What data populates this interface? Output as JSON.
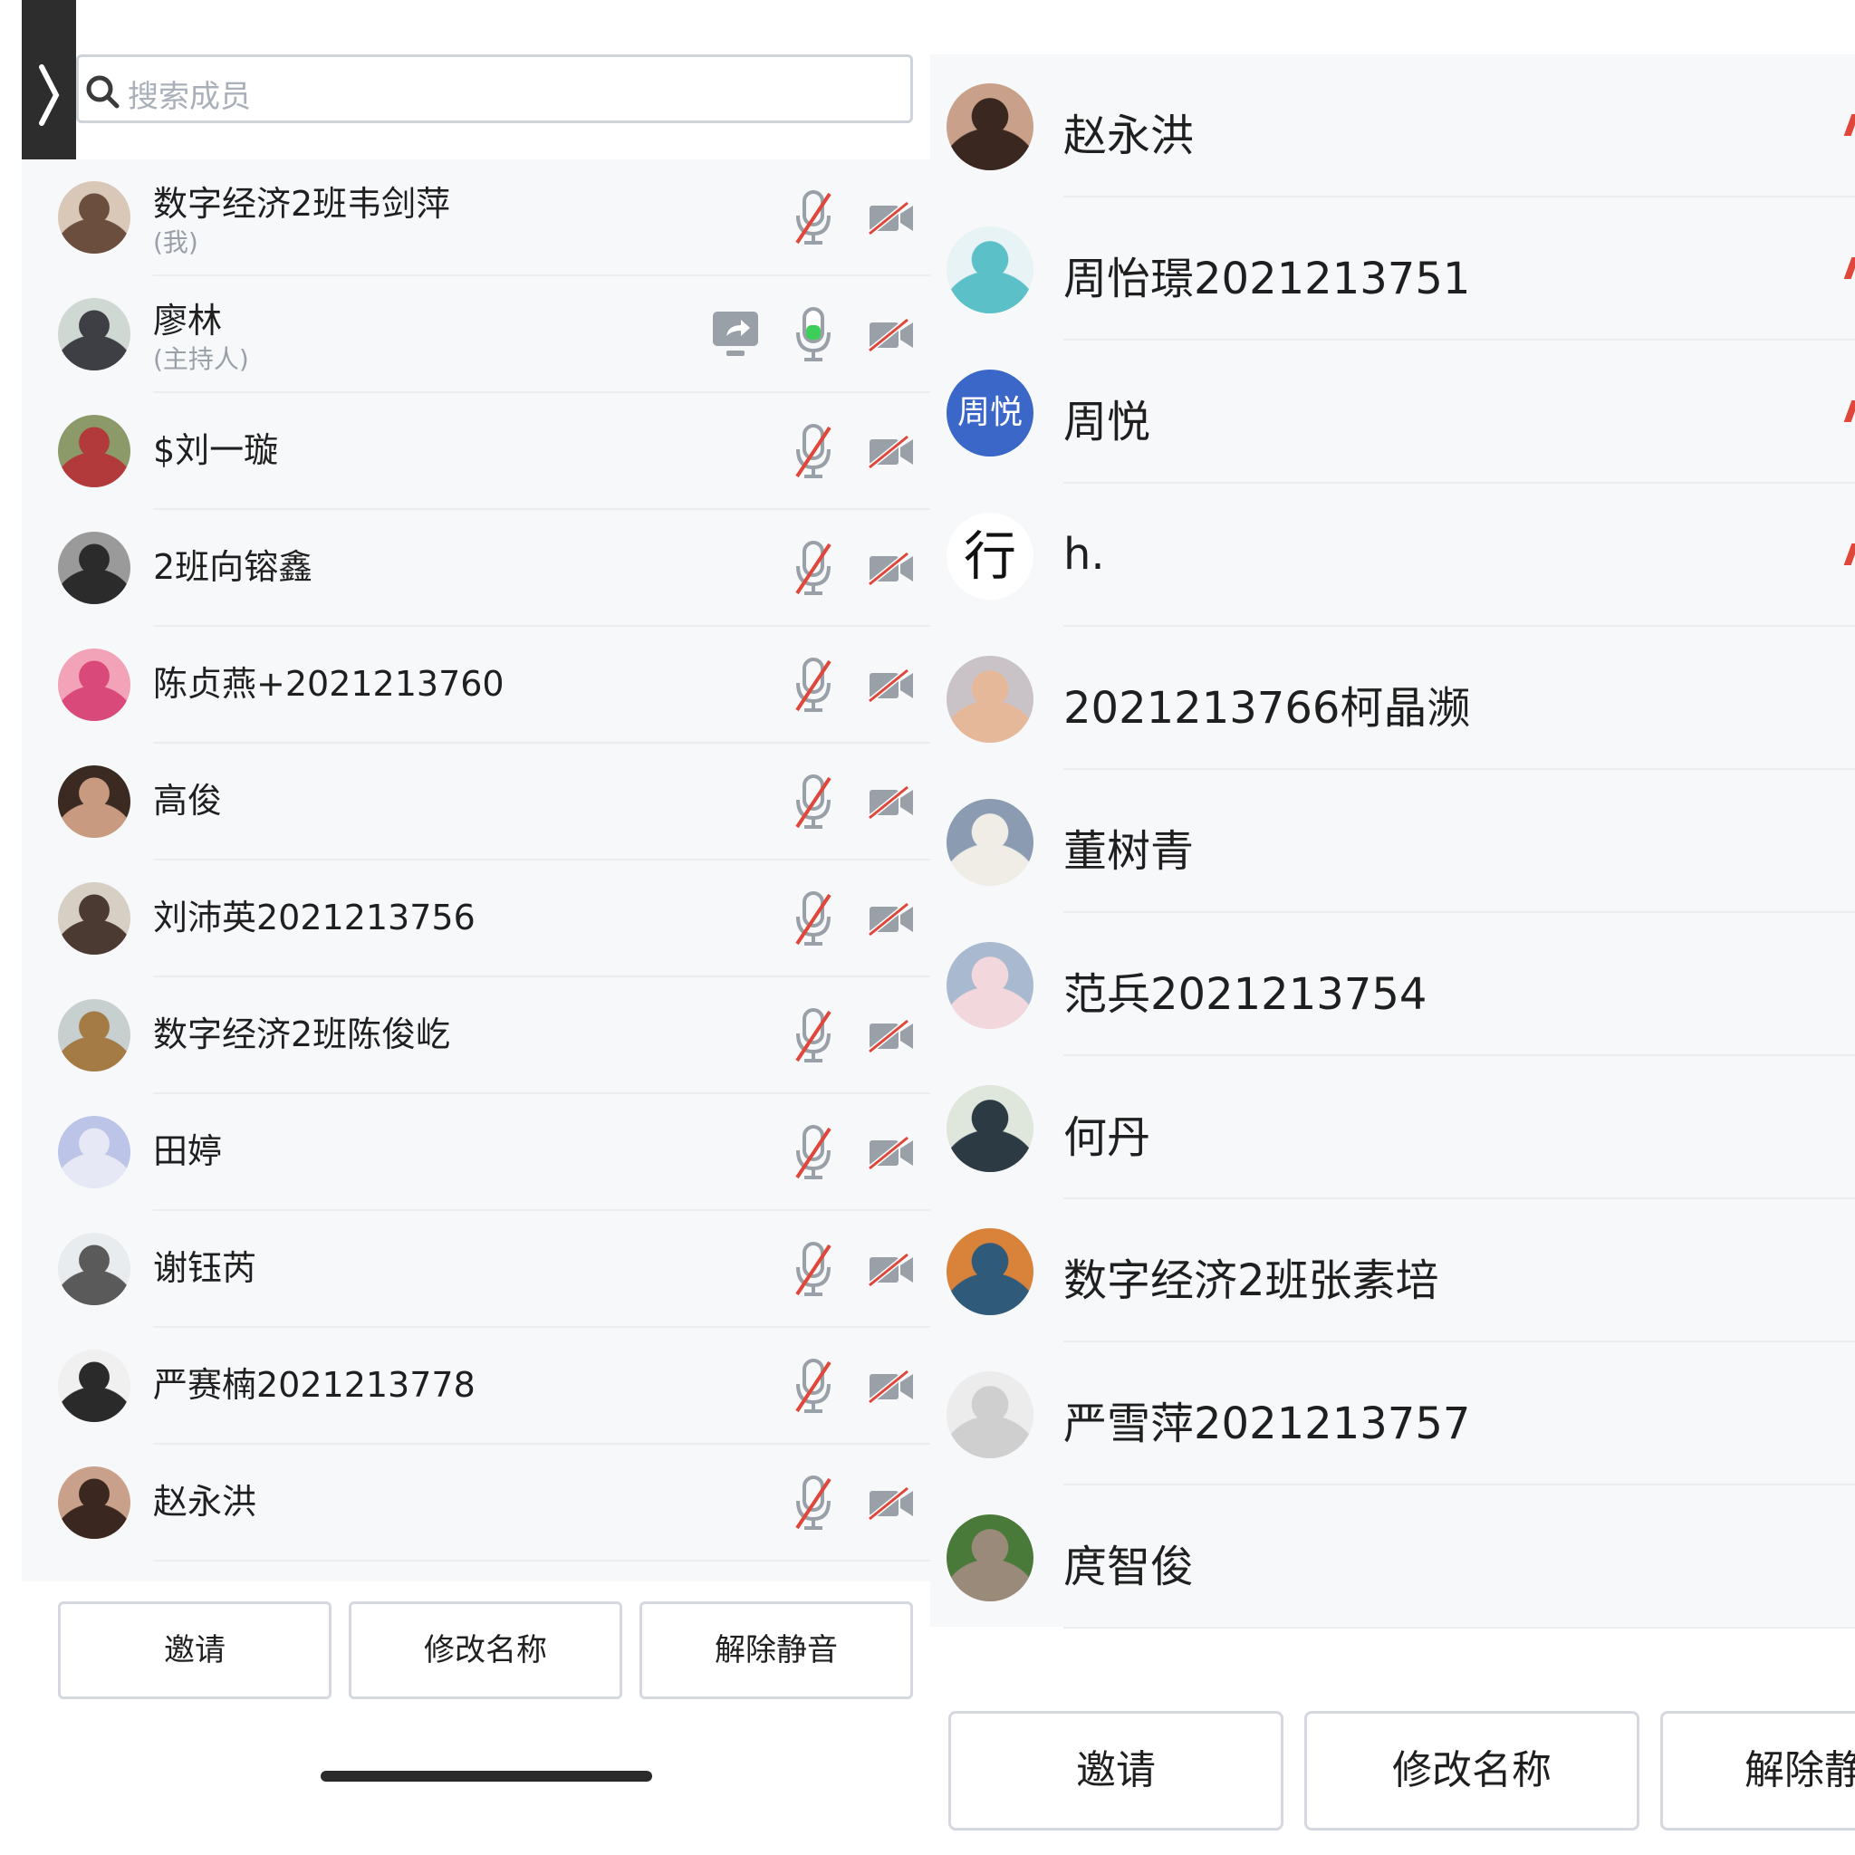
{
  "left_panel": {
    "search": {
      "placeholder": "搜索成员"
    },
    "members": [
      {
        "name": "数字经济2班韦剑萍",
        "role": "(我)",
        "mic": "muted",
        "cam": "off",
        "avatar": "photo"
      },
      {
        "name": "廖林",
        "role": "(主持人)",
        "mic": "on",
        "cam": "off",
        "sharing": true,
        "avatar": "photo"
      },
      {
        "name": "$刘一璇",
        "mic": "muted",
        "cam": "off",
        "avatar": "photo"
      },
      {
        "name": "2班向镕鑫",
        "mic": "muted",
        "cam": "off",
        "avatar": "photo"
      },
      {
        "name": "陈贞燕+2021213760",
        "mic": "muted",
        "cam": "off",
        "avatar": "photo"
      },
      {
        "name": "高俊",
        "mic": "muted",
        "cam": "off",
        "avatar": "photo"
      },
      {
        "name": "刘沛英2021213756",
        "mic": "muted",
        "cam": "off",
        "avatar": "photo"
      },
      {
        "name": "数字经济2班陈俊屹",
        "mic": "muted",
        "cam": "off",
        "avatar": "photo"
      },
      {
        "name": "田婷",
        "mic": "muted",
        "cam": "off",
        "avatar": "photo"
      },
      {
        "name": "谢钰芮",
        "mic": "muted",
        "cam": "off",
        "avatar": "photo"
      },
      {
        "name": "严赛楠2021213778",
        "mic": "muted",
        "cam": "off",
        "avatar": "photo"
      },
      {
        "name": "赵永洪",
        "mic": "muted",
        "cam": "off",
        "avatar": "photo"
      }
    ],
    "buttons": {
      "invite": "邀请",
      "rename": "修改名称",
      "unmute": "解除静音"
    }
  },
  "right_panel": {
    "members": [
      {
        "name": "赵永洪",
        "avatar": "photo"
      },
      {
        "name": "周怡璟2021213751",
        "avatar": "photo"
      },
      {
        "name": "周悦",
        "avatar": "initials",
        "initials": "周悦"
      },
      {
        "name": "h.",
        "avatar": "calligraphy",
        "glyph": "行"
      },
      {
        "name": "2021213766柯晶濒",
        "avatar": "photo"
      },
      {
        "name": "董树青",
        "avatar": "photo"
      },
      {
        "name": "范兵2021213754",
        "avatar": "photo"
      },
      {
        "name": "何丹",
        "avatar": "photo"
      },
      {
        "name": "数字经济2班张素培",
        "avatar": "photo"
      },
      {
        "name": "严雪萍2021213757",
        "avatar": "photo"
      },
      {
        "name": "庹智俊",
        "avatar": "photo"
      }
    ],
    "buttons": {
      "invite": "邀请",
      "rename": "修改名称",
      "unmute": "解除静"
    }
  },
  "colors": {
    "accent_blue": "#3a67c8",
    "mute_red": "#e0473b",
    "mic_on_green": "#3ecf5a",
    "icon_gray": "#9aa0a8",
    "list_bg": "#f7f8fa"
  }
}
